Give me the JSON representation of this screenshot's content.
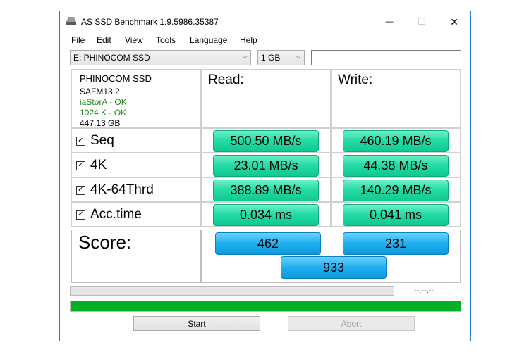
{
  "window": {
    "title": "AS SSD Benchmark 1.9.5986.35387",
    "minimize_glyph": "—",
    "maximize_glyph": "☐",
    "close_glyph": "✕"
  },
  "menu": [
    {
      "label": "File"
    },
    {
      "label": "Edit"
    },
    {
      "label": "View"
    },
    {
      "label": "Tools"
    },
    {
      "label": "Language"
    },
    {
      "label": "Help"
    }
  ],
  "toolbar": {
    "drive_select": "E: PHINOCOM SSD",
    "size_select": "1 GB",
    "search_value": ""
  },
  "info": {
    "model": "PHINOCOM SSD",
    "firmware": "SAFM13.2",
    "driver": "iaStorA - OK",
    "alignment": "1024 K - OK",
    "capacity": "447.13 GB"
  },
  "headers": {
    "read": "Read:",
    "write": "Write:"
  },
  "tests": [
    {
      "label": "Seq",
      "checked": "☑",
      "read": "500.50 MB/s",
      "write": "460.19 MB/s"
    },
    {
      "label": "4K",
      "checked": "☑",
      "read": "23.01 MB/s",
      "write": "44.38 MB/s"
    },
    {
      "label": "4K-64Thrd",
      "checked": "☑",
      "read": "388.89 MB/s",
      "write": "140.29 MB/s"
    },
    {
      "label": "Acc.time",
      "checked": "☑",
      "read": "0.034 ms",
      "write": "0.041 ms"
    }
  ],
  "score": {
    "label": "Score:",
    "read": "462",
    "write": "231",
    "total": "933"
  },
  "progress": {
    "time": "--:--:--",
    "upper_fill": 0,
    "lower_fill": 1.0
  },
  "buttons": {
    "start": "Start",
    "abort": "Abort"
  },
  "colors": {
    "accent_green": "#22d8a2",
    "accent_blue": "#1fb0f0",
    "progress_green": "#06b025",
    "info_ok": "#1f8a1f"
  },
  "icons": {
    "app": "ssd-drive-icon"
  }
}
